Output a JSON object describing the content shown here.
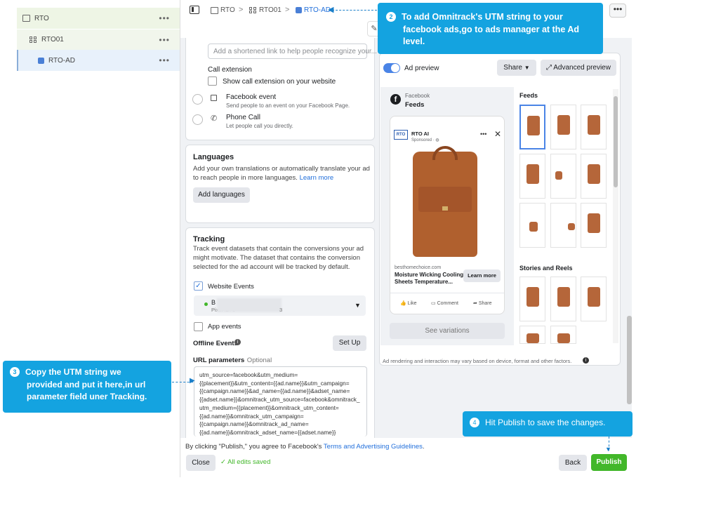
{
  "tree": {
    "items": [
      {
        "label": "RTO"
      },
      {
        "label": "RTO01"
      },
      {
        "label": "RTO-AD"
      }
    ],
    "more": "•••"
  },
  "breadcrumb": [
    "RTO",
    "RTO01",
    "RTO-AD"
  ],
  "topbar": {
    "more": "•••"
  },
  "destination": {
    "link_placeholder": "Add a shortened link to help people recognize your...",
    "call_extension_title": "Call extension",
    "call_extension_check": "Show call extension on your website",
    "facebook_event_title": "Facebook event",
    "facebook_event_desc": "Send people to an event on your Facebook Page.",
    "phone_call_title": "Phone Call",
    "phone_call_desc": "Let people call you directly."
  },
  "languages": {
    "title": "Languages",
    "desc_1": "Add your own translations or automatically translate your ad",
    "desc_2": "to reach people in more languages.",
    "learn_more": "Learn more",
    "button": "Add languages"
  },
  "tracking": {
    "title": "Tracking",
    "desc": [
      "Track event datasets that contain the conversions your ad",
      "might motivate. The dataset that contains the conversion",
      "selected for the ad account will be tracked by default."
    ],
    "website_events": "Website Events",
    "dataset_name": "B",
    "pixel_id_label": "Pixel ID: 5",
    "pixel_id_tail": "3",
    "app_events": "App events",
    "offline_events": "Offline Events",
    "setup_button": "Set Up",
    "url_params_label": "URL parameters",
    "optional": "· Optional",
    "url_params_lines": [
      "utm_source=facebook&utm_medium=",
      "{{placement}}&utm_content={{ad.name}}&utm_campaign=",
      "{{campaign.name}}&ad_name={{ad.name}}&adset_name=",
      "{{adset.name}}&omnitrack_utm_source=facebook&omnitrack_",
      "utm_medium={{placement}}&omnitrack_utm_content=",
      "{{ad.name}}&omnitrack_utm_campaign=",
      "{{campaign.name}}&omnitrack_ad_name=",
      "{{ad.name}}&omnitrack_adset_name={{adset.name}}"
    ]
  },
  "preview": {
    "ad_preview": "Ad preview",
    "share": "Share",
    "advanced": "Advanced preview",
    "platform": "Facebook",
    "placement": "Feeds",
    "page_name": "RTO AI",
    "sponsored": "Sponsored · ",
    "domain": "besthomechoice.com",
    "headline_1": "Moisture Wicking Cooling",
    "headline_2": "Sheets Temperature...",
    "cta": "Learn more",
    "like": "Like",
    "comment": "Comment",
    "share_action": "Share",
    "see_variations": "See variations",
    "feeds_title": "Feeds",
    "stories_title": "Stories and Reels",
    "disclaimer": "Ad rendering and interaction may vary based on device, format and other factors.",
    "logo_text": "RTO"
  },
  "bottom": {
    "terms_prefix": "By clicking \"Publish,\" you agree to Facebook's ",
    "terms_link": "Terms and Advertising Guidelines",
    "terms_suffix": ".",
    "close": "Close",
    "saved": "All edits saved",
    "back": "Back",
    "publish": "Publish"
  },
  "callouts": {
    "c2_num": "2",
    "c2": [
      "To add Omnitrack's UTM string to your",
      "facebook ads,go to ads manager at the Ad",
      "level."
    ],
    "c3_num": "3",
    "c3": [
      "Copy the UTM string we",
      "provided and put it here,in url",
      "parameter  field uner Tracking."
    ],
    "c4_num": "4",
    "c4": "Hit Publish to save the changes."
  },
  "colors": {
    "accent": "#14a3e0",
    "publish": "#42b72a",
    "link": "#216fdb"
  }
}
